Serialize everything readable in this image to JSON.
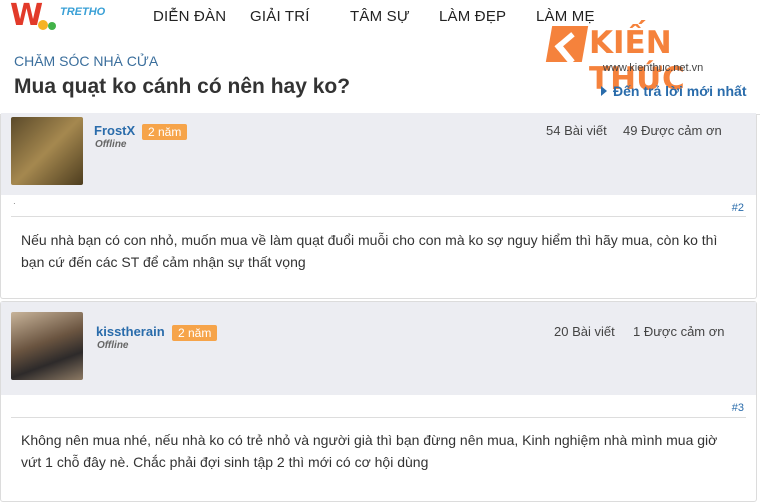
{
  "header": {
    "logo_text": "TRETHO",
    "nav": [
      "DIỄN ĐÀN",
      "GIẢI TRÍ",
      "TÂM SỰ",
      "LÀM ĐẸP",
      "LÀM MẸ"
    ],
    "brand_name": "KIẾN THỨC",
    "brand_url": "www.kienthuc.net.vn"
  },
  "thread": {
    "category": "CHĂM SÓC NHÀ CỬA",
    "title": "Mua quạt ko cánh có nên hay ko?",
    "jump_label": "Đến trả lời mới nhất"
  },
  "posts": [
    {
      "username": "FrostX",
      "badge": "2 năm",
      "status": "Offline",
      "post_count": "54 Bài viết",
      "thanks": "49 Được cảm ơn",
      "number": "#2",
      "message": "Nếu nhà bạn có con nhỏ, muốn mua về làm quạt đuổi muỗi cho con mà ko sợ nguy hiểm thì hãy mua, còn ko thì bạn cứ đến các ST để cảm nhận sự thất vọng"
    },
    {
      "username": "kisstherain",
      "badge": "2 năm",
      "status": "Offline",
      "post_count": "20 Bài viết",
      "thanks": "1 Được cảm ơn",
      "number": "#3",
      "message": "Không nên mua nhé, nếu nhà ko có trẻ nhỏ và người già thì bạn đừng nên mua, Kinh nghiệm nhà mình mua giờ vứt 1 chỗ đây nè. Chắc phải đợi sinh tập 2 thì mới có cơ hội dùng"
    }
  ]
}
